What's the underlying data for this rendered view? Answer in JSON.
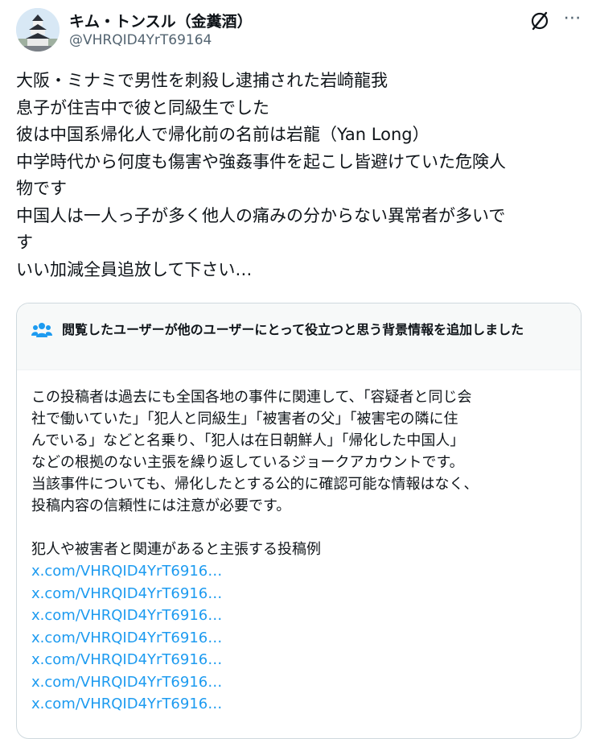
{
  "author": {
    "display_name": "キム・トンスル（金糞酒）",
    "handle": "@VHRQID4YrT69164"
  },
  "header_icons": {
    "grok": "grok-icon",
    "more": "more-icon"
  },
  "post": {
    "lines": [
      "大阪・ミナミで男性を刺殺し逮捕された岩崎龍我",
      "息子が住吉中で彼と同級生でした",
      "彼は中国系帰化人で帰化前の名前は岩龍（Yan Long）",
      "中学時代から何度も傷害や強姦事件を起こし皆避けていた危険人",
      "物です",
      "中国人は一人っ子が多く他人の痛みの分からない異常者が多いで",
      "す",
      "いい加減全員追放して下さい…"
    ]
  },
  "community_note": {
    "icon": "people-icon",
    "title": "閲覧したユーザーが他のユーザーにとって役立つと思う背景情報を追加しました",
    "lines": [
      "この投稿者は過去にも全国各地の事件に関連して、「容疑者と同じ会",
      "社で働いていた」「犯人と同級生」「被害者の父」「被害宅の隣に住",
      "んでいる」などと名乗り、「犯人は在日朝鮮人」「帰化した中国人」",
      "などの根拠のない主張を繰り返しているジョークアカウントです。",
      "当該事件についても、帰化したとする公的に確認可能な情報はなく、",
      "投稿内容の信頼性には注意が必要です。"
    ],
    "examples_label": "犯人や被害者と関連があると主張する投稿例",
    "links": [
      "x.com/VHRQID4YrT6916…",
      "x.com/VHRQID4YrT6916…",
      "x.com/VHRQID4YrT6916…",
      "x.com/VHRQID4YrT6916…",
      "x.com/VHRQID4YrT6916…",
      "x.com/VHRQID4YrT6916…",
      "x.com/VHRQID4YrT6916…"
    ]
  },
  "colors": {
    "text": "#0f1419",
    "secondary": "#536471",
    "link": "#1d9bf0",
    "note_header_bg": "#f7f9f9",
    "border": "#cfd9de"
  }
}
